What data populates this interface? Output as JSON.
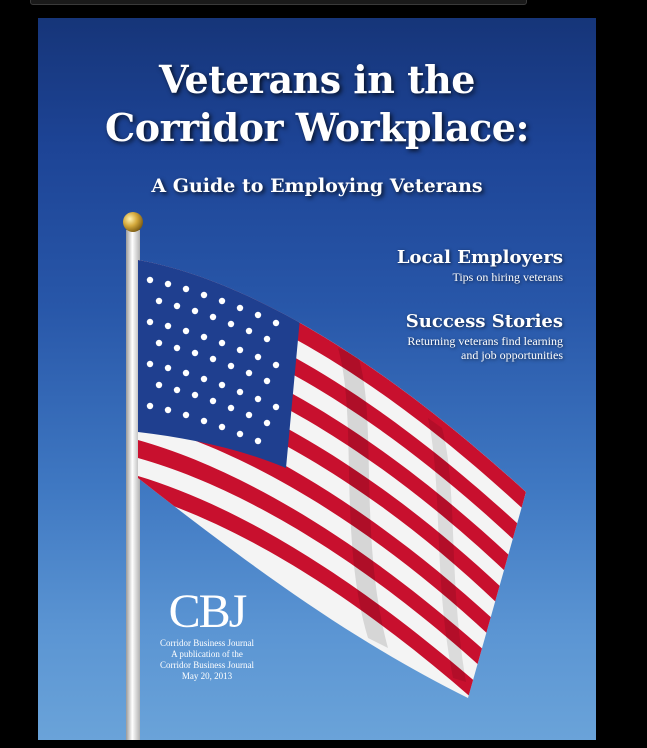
{
  "cover": {
    "title_line1": "Veterans in the",
    "title_line2": "Corridor Workplace:",
    "subtitle": "A Guide to Employing Veterans",
    "sections": [
      {
        "heading": "Local Employers",
        "lines": [
          "Tips on hiring veterans"
        ]
      },
      {
        "heading": "Success Stories",
        "lines": [
          "Returning veterans find learning",
          "and job opportunities"
        ]
      }
    ],
    "logo": {
      "mark": "CBJ",
      "name": "Corridor Business Journal",
      "publication_line1": "A publication of the",
      "publication_line2": "Corridor Business Journal",
      "date": "May 20, 2013"
    }
  },
  "colors": {
    "sky_top": "#163579",
    "sky_bottom": "#6aa3d9",
    "canton": "#1f3f8f",
    "stripe_red": "#c8102e",
    "stripe_white": "#f4f4f4",
    "pole": "#e8e8e8",
    "finial": "#c9a340"
  }
}
